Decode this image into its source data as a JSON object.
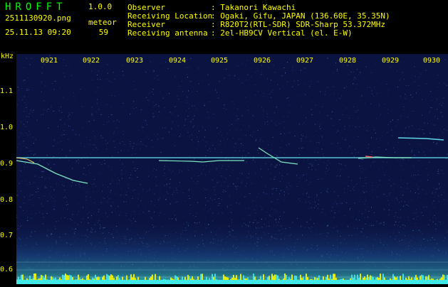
{
  "app": {
    "name": "HROFFT",
    "version": "1.0.0"
  },
  "file": {
    "name": "2511130920.png",
    "datetime": "25.11.13 09:20"
  },
  "meteor": {
    "label": "meteor",
    "count": "59"
  },
  "info": [
    {
      "label": "Observer",
      "value": ": Takanori Kawachi"
    },
    {
      "label": "Receiving Location",
      "value": ": Ogaki, Gifu, JAPAN (136.60E, 35.35N)"
    },
    {
      "label": "Receiver",
      "value": ": R820T2(RTL-SDR) SDR-Sharp 53.372MHz"
    },
    {
      "label": "Receiving antenna",
      "value": ": 2el-HB9CV Vertical (el. E-W)"
    }
  ],
  "axis": {
    "y_unit": "kHz",
    "y_ticks": [
      "1.1",
      "1.0",
      "0.9",
      "0.8",
      "0.7",
      "0.6"
    ],
    "x_ticks": [
      "0921",
      "0922",
      "0923",
      "0924",
      "0925",
      "0926",
      "0927",
      "0928",
      "0929",
      "0930"
    ]
  },
  "colors": {
    "header_text": "#00ff00",
    "accent_text": "#ffff00",
    "background": "#0b1340",
    "trace": "#6fe0c8"
  }
}
